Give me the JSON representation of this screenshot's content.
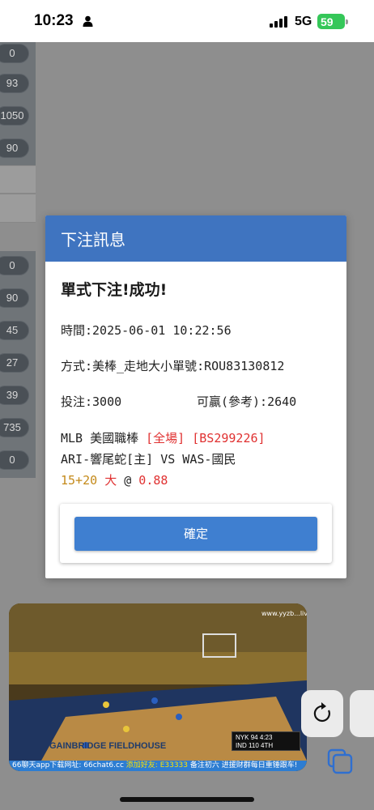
{
  "status_bar": {
    "time": "10:23",
    "network": "5G",
    "battery": "59",
    "icons": [
      "person-icon",
      "signal-bars-icon",
      "battery-icon"
    ]
  },
  "background": {
    "pills_top": [
      "0",
      "93",
      "1050",
      "90"
    ],
    "pills_bottom": [
      "0",
      "90",
      "45",
      "27",
      "39",
      "735",
      "0"
    ]
  },
  "dialog": {
    "title": "下注訊息",
    "success": "單式下注!成功!",
    "time_line": "時間:2025-06-01 10:22:56",
    "method_line": "方式:美棒_走地大小單號:ROU83130812",
    "stake_line": "投注:3000",
    "win_line": "可贏(參考):2640",
    "league": "MLB 美國職棒",
    "period": "[全場]",
    "bet_code": "[BS299226]",
    "matchup": "ARI-響尾蛇[主] VS WAS-國民",
    "score": "15+20",
    "pick": "大",
    "at": "@",
    "odds": "0.88",
    "confirm": "確定"
  },
  "video": {
    "watermark": "www.yyzb...live",
    "court_text": "GAINBRIDGE FIELDHOUSE",
    "scorebug": {
      "team1": "NYK",
      "score1": "94",
      "team2": "IND",
      "score2": "110",
      "clock": "4:23",
      "quarter": "4TH"
    },
    "ticker_left": "66聊天app下载网址: 66chat6.cc",
    "ticker_mid": "添加好友: E33333",
    "ticker_right": "备注初六 进援财群每日重锤跟车!"
  },
  "controls": {
    "icons": [
      "reload-icon",
      "tabs-icon"
    ]
  }
}
